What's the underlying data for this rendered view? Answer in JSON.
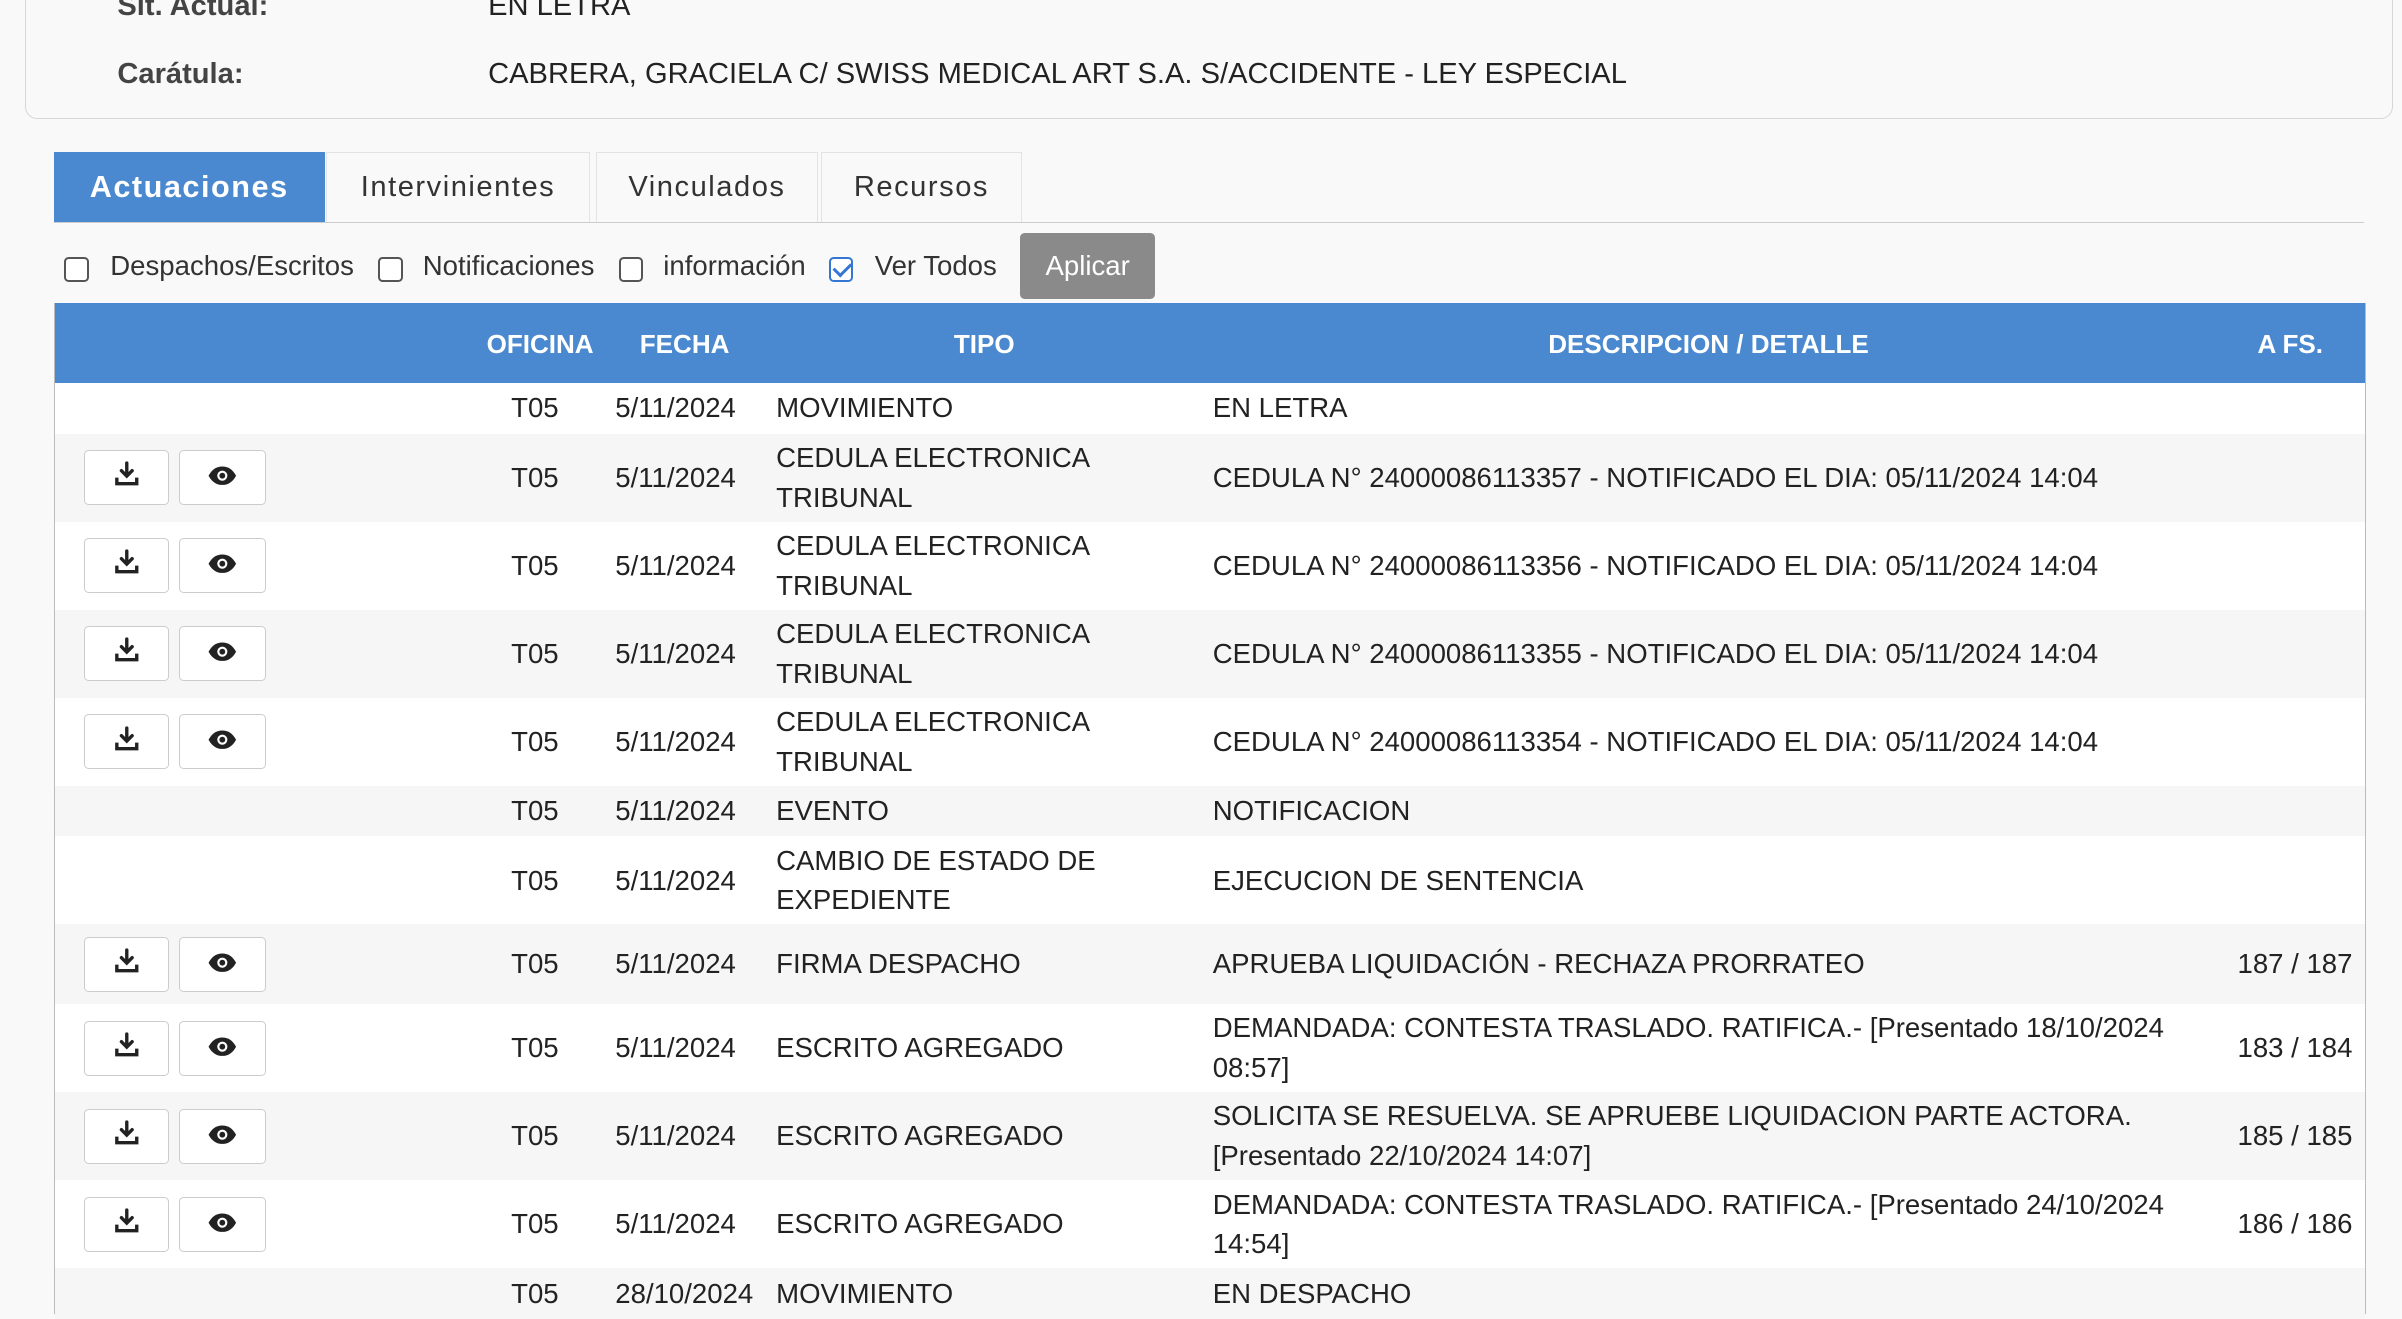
{
  "case_info": {
    "sit_actual_label": "Sit. Actual:",
    "sit_actual_value": "EN LETRA",
    "caratula_label": "Carátula:",
    "caratula_value": "CABRERA, GRACIELA C/ SWISS MEDICAL ART S.A. S/ACCIDENTE - LEY ESPECIAL"
  },
  "tabs": [
    "Actuaciones",
    "Intervinientes",
    "Vinculados",
    "Recursos"
  ],
  "active_tab": "Actuaciones",
  "filters": {
    "items": [
      {
        "label": "Despachos/Escritos",
        "checked": false
      },
      {
        "label": "Notificaciones",
        "checked": false
      },
      {
        "label": "información",
        "checked": false
      },
      {
        "label": "Ver Todos",
        "checked": true
      }
    ],
    "apply_label": "Aplicar"
  },
  "table": {
    "headers": {
      "oficina": "OFICINA",
      "fecha": "FECHA",
      "tipo": "TIPO",
      "descripcion": "DESCRIPCION / DETALLE",
      "afs": "A FS."
    },
    "icons": {
      "download": "download-icon",
      "view": "eye-icon"
    },
    "rows": [
      {
        "oficina": "T05",
        "fecha": "5/11/2024",
        "tipo": [
          "MOVIMIENTO"
        ],
        "descripcion": [
          "EN LETRA"
        ],
        "afs": "",
        "actions": false
      },
      {
        "oficina": "T05",
        "fecha": "5/11/2024",
        "tipo": [
          "CEDULA ELECTRONICA",
          "TRIBUNAL"
        ],
        "descripcion": [
          "CEDULA N° 24000086113357 - NOTIFICADO EL DIA: 05/11/2024 14:04"
        ],
        "afs": "",
        "actions": true
      },
      {
        "oficina": "T05",
        "fecha": "5/11/2024",
        "tipo": [
          "CEDULA ELECTRONICA",
          "TRIBUNAL"
        ],
        "descripcion": [
          "CEDULA N° 24000086113356 - NOTIFICADO EL DIA: 05/11/2024 14:04"
        ],
        "afs": "",
        "actions": true
      },
      {
        "oficina": "T05",
        "fecha": "5/11/2024",
        "tipo": [
          "CEDULA ELECTRONICA",
          "TRIBUNAL"
        ],
        "descripcion": [
          "CEDULA N° 24000086113355 - NOTIFICADO EL DIA: 05/11/2024 14:04"
        ],
        "afs": "",
        "actions": true
      },
      {
        "oficina": "T05",
        "fecha": "5/11/2024",
        "tipo": [
          "CEDULA ELECTRONICA",
          "TRIBUNAL"
        ],
        "descripcion": [
          "CEDULA N° 24000086113354 - NOTIFICADO EL DIA: 05/11/2024 14:04"
        ],
        "afs": "",
        "actions": true
      },
      {
        "oficina": "T05",
        "fecha": "5/11/2024",
        "tipo": [
          "EVENTO"
        ],
        "descripcion": [
          "NOTIFICACION"
        ],
        "afs": "",
        "actions": false
      },
      {
        "oficina": "T05",
        "fecha": "5/11/2024",
        "tipo": [
          "CAMBIO DE ESTADO DE",
          "EXPEDIENTE"
        ],
        "descripcion": [
          "EJECUCION DE SENTENCIA"
        ],
        "afs": "",
        "actions": false
      },
      {
        "oficina": "T05",
        "fecha": "5/11/2024",
        "tipo": [
          "FIRMA DESPACHO"
        ],
        "descripcion": [
          "APRUEBA LIQUIDACIÓN - RECHAZA PRORRATEO"
        ],
        "afs": "187 / 187",
        "actions": true
      },
      {
        "oficina": "T05",
        "fecha": "5/11/2024",
        "tipo": [
          "ESCRITO AGREGADO"
        ],
        "descripcion": [
          "DEMANDADA: CONTESTA TRASLADO. RATIFICA.- [Presentado 18/10/2024",
          "08:57]"
        ],
        "afs": "183 / 184",
        "actions": true
      },
      {
        "oficina": "T05",
        "fecha": "5/11/2024",
        "tipo": [
          "ESCRITO AGREGADO"
        ],
        "descripcion": [
          "SOLICITA SE RESUELVA. SE APRUEBE LIQUIDACION PARTE ACTORA.",
          "[Presentado 22/10/2024 14:07]"
        ],
        "afs": "185 / 185",
        "actions": true
      },
      {
        "oficina": "T05",
        "fecha": "5/11/2024",
        "tipo": [
          "ESCRITO AGREGADO"
        ],
        "descripcion": [
          "DEMANDADA: CONTESTA TRASLADO. RATIFICA.- [Presentado 24/10/2024",
          "14:54]"
        ],
        "afs": "186 / 186",
        "actions": true
      },
      {
        "oficina": "T05",
        "fecha": "28/10/2024",
        "tipo": [
          "MOVIMIENTO"
        ],
        "descripcion": [
          "EN DESPACHO"
        ],
        "afs": "",
        "actions": false
      }
    ]
  }
}
